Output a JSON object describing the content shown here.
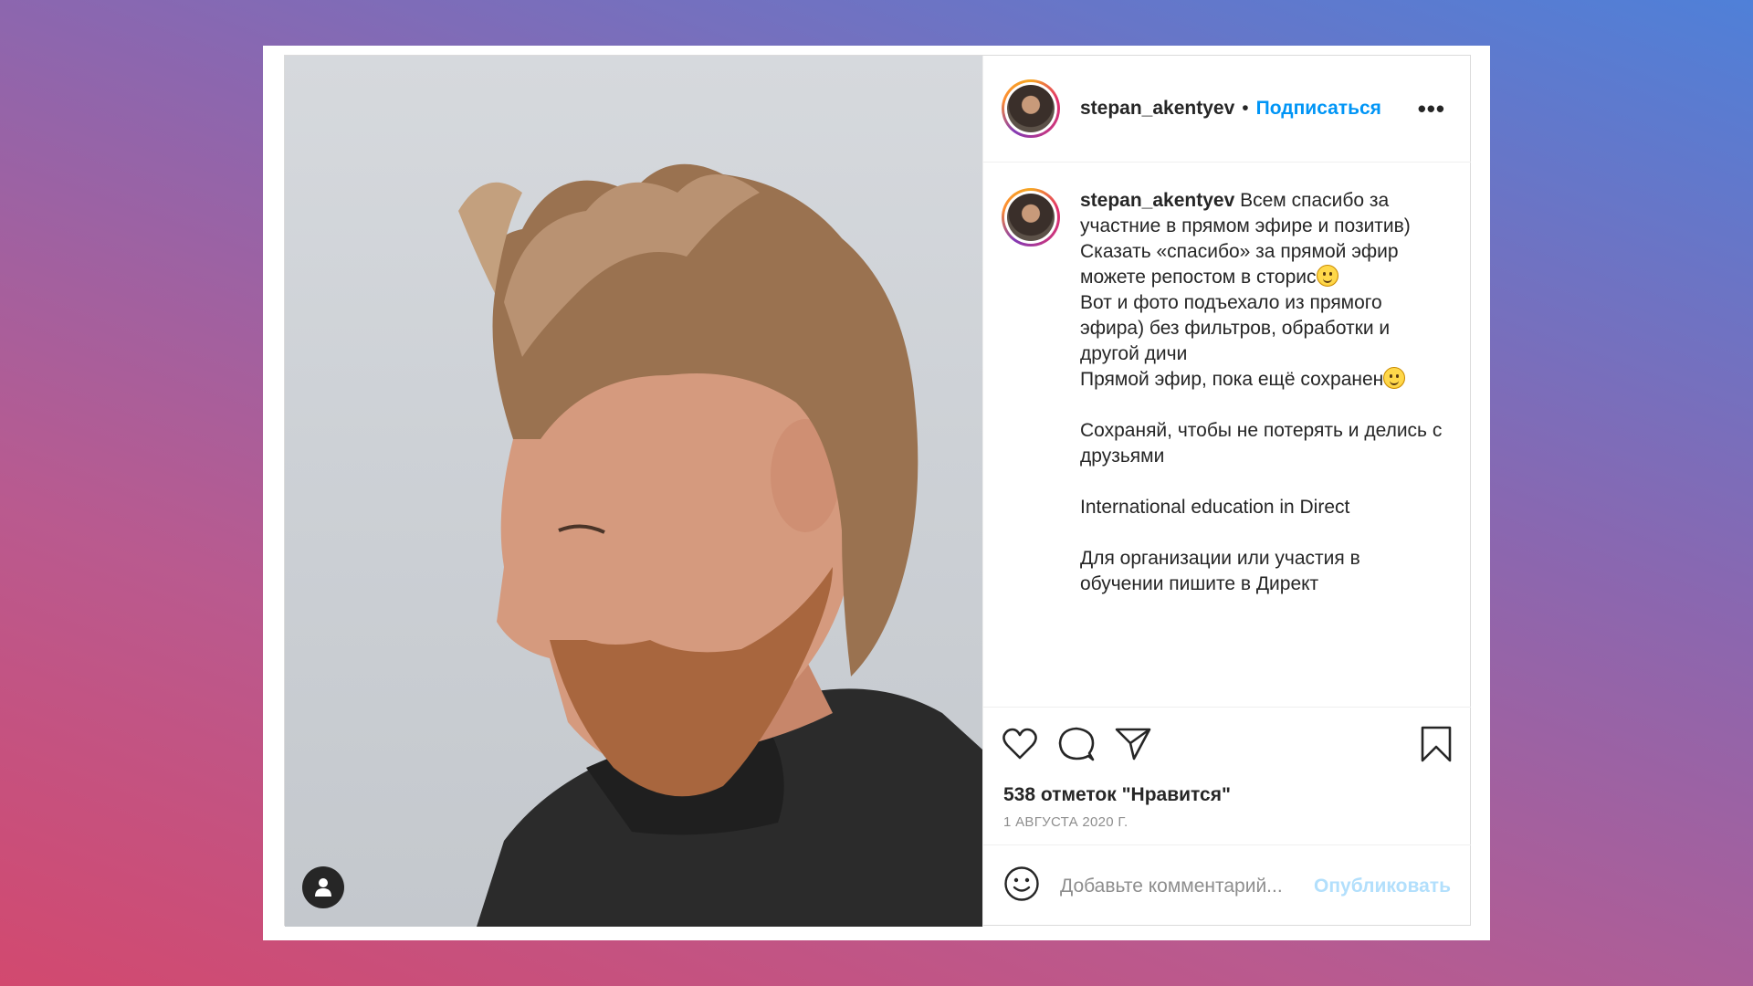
{
  "post": {
    "username": "stepan_akentyev",
    "follow_separator": "•",
    "follow_label": "Подписаться",
    "more_label": "•••",
    "caption": {
      "username": "stepan_akentyev",
      "first_line": "Всем спасибо за участние в прямом эфире и позитив)",
      "line_2": "Сказать «спасибо» за прямой эфир можете репостом в сторис",
      "line_3": "Вот и фото подъехало из прямого эфира) без фильтров, обработки и другой дичи",
      "line_4": "Прямой эфир, пока ещё сохранен",
      "line_5": "Сохраняй, чтобы не потерять и делись с друзьями",
      "line_6": "International education in Direct",
      "line_7": "Для организации или участия в обучении пишите в Директ"
    },
    "likes_text": "538 отметок \"Нравится\"",
    "date_text": "1 АВГУСТА 2020 Г.",
    "comment_placeholder": "Добавьте комментарий...",
    "publish_label": "Опубликовать"
  },
  "icons": {
    "like": "heart-icon",
    "comment": "comment-icon",
    "share": "share-icon",
    "save": "bookmark-icon",
    "emoji": "smiley-icon",
    "tag": "user-tag-icon"
  },
  "colors": {
    "accent": "#0095f6",
    "publish_disabled": "#b2dffc",
    "text": "#262626",
    "muted": "#8e8e8e"
  }
}
